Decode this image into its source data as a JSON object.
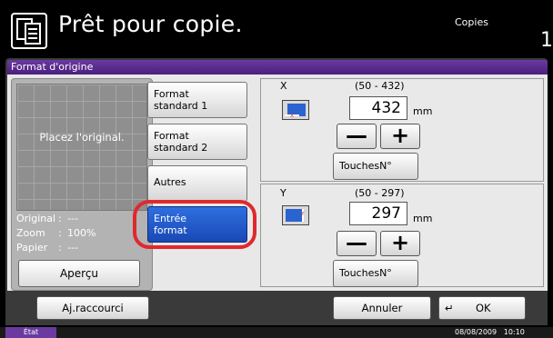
{
  "header": {
    "title": "Prêt pour copie.",
    "copies_label": "Copies",
    "copies_value": "1"
  },
  "panel": {
    "title": "Format d'origine"
  },
  "preview": {
    "message": "Placez l'original.",
    "stats": [
      {
        "label": "Original",
        "sep": ":",
        "value": "---"
      },
      {
        "label": "Zoom",
        "sep": ":",
        "value": "100%"
      },
      {
        "label": "Papier",
        "sep": ":",
        "value": "---"
      }
    ],
    "button_label": "Aperçu"
  },
  "formats": [
    {
      "label": "Format\nstandard 1",
      "selected": false
    },
    {
      "label": "Format\nstandard 2",
      "selected": false
    },
    {
      "label": "Autres",
      "selected": false
    },
    {
      "label": "Entrée\nformat",
      "selected": true
    }
  ],
  "dimensions": {
    "x": {
      "axis": "X",
      "range": "(50 - 432)",
      "value": "432",
      "unit": "mm",
      "keys_label": "TouchesN°"
    },
    "y": {
      "axis": "Y",
      "range": "(50 - 297)",
      "value": "297",
      "unit": "mm",
      "keys_label": "TouchesN°"
    }
  },
  "step": {
    "minus": "—",
    "plus": "+"
  },
  "bottom": {
    "shortcut_label": "Aj.raccourci",
    "cancel_label": "Annuler",
    "ok_label": "OK",
    "ok_icon": "↵"
  },
  "status": {
    "label": "État",
    "datetime": "08/08/2009   10:10"
  },
  "colors": {
    "accent_purple": "#6a3aa0",
    "selected_blue": "#1f5ad6",
    "highlight_red": "#e0282e"
  }
}
